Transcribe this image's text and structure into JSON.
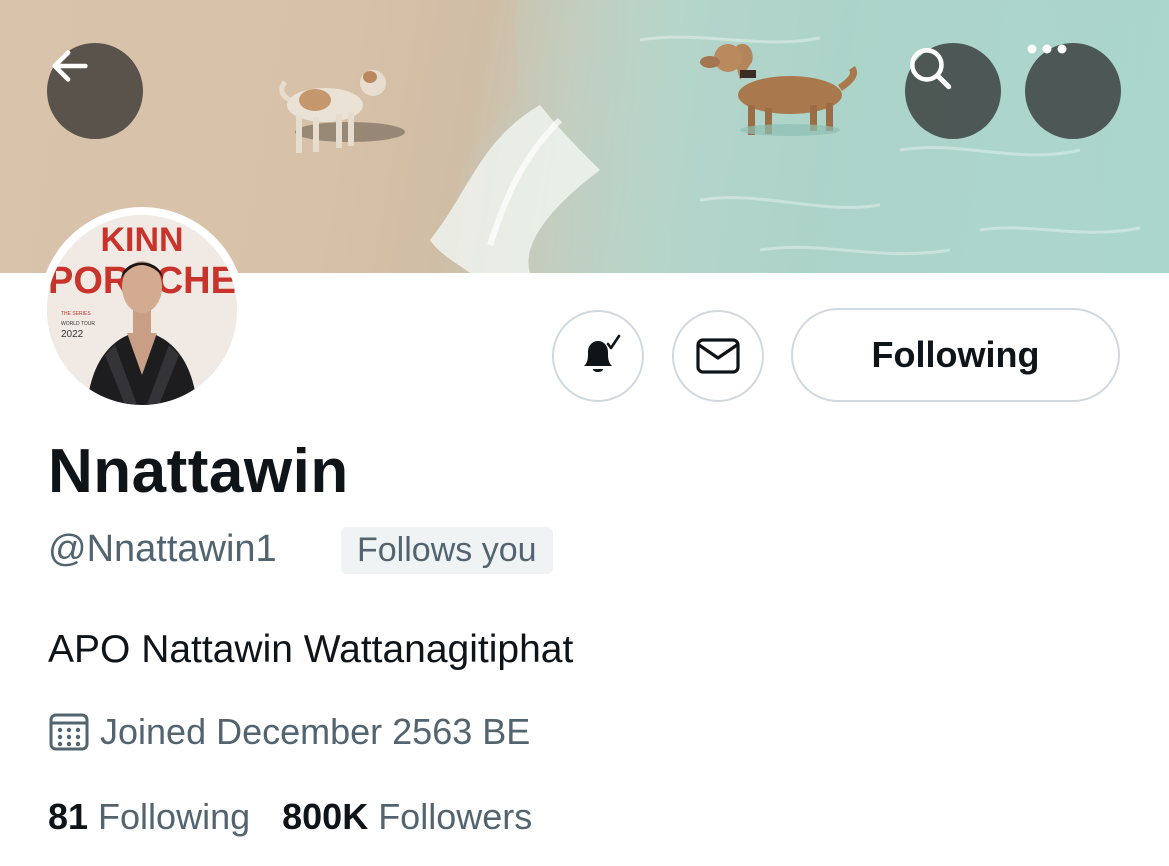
{
  "header": {
    "back_icon": "arrow-left-icon",
    "search_icon": "search-icon",
    "more_icon": "more-horizontal-icon"
  },
  "avatar": {
    "lines": [
      "KINN",
      "PORSCHE"
    ],
    "tagline": [
      "THE SERIES",
      "WORLD TOUR",
      "2022"
    ],
    "brand_color": "#c8332b"
  },
  "actions": {
    "notify_icon": "bell-checked-icon",
    "message_icon": "envelope-icon",
    "following_label": "Following"
  },
  "profile": {
    "display_name": "Nnattawin",
    "handle": "@Nnattawin1",
    "follows_you": "Follows you",
    "bio": "APO Nattawin Wattanagitiphat",
    "joined": "Joined December 2563 BE",
    "joined_icon": "calendar-icon"
  },
  "stats": {
    "following_count": "81",
    "following_label": "Following",
    "followers_count": "800K",
    "followers_label": "Followers"
  },
  "colors": {
    "text_primary": "#0f1419",
    "text_secondary": "#536471",
    "border": "#cfd9de",
    "badge_bg": "#eff3f4"
  }
}
